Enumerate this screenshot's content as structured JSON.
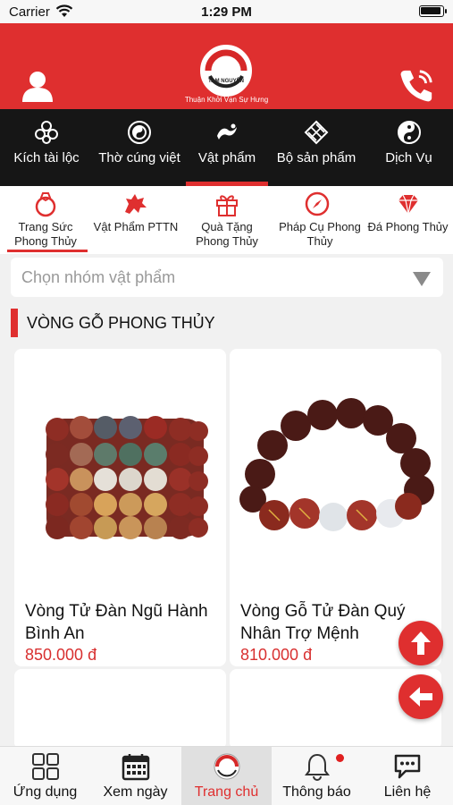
{
  "status_bar": {
    "carrier": "Carrier",
    "time": "1:29 PM"
  },
  "header": {
    "logo_text": "TAM NGUYÊN",
    "tagline": "Thuận Khởi Vạn Sự Hưng",
    "brand_color": "#df2f2f"
  },
  "categories": [
    {
      "label": "Kích tài lộc",
      "icon": "lotus-knot-icon"
    },
    {
      "label": "Thờ cúng việt",
      "icon": "bagua-icon"
    },
    {
      "label": "Vật phẩm",
      "icon": "dragon-icon",
      "active": true
    },
    {
      "label": "Bộ sản phẩm",
      "icon": "endless-knot-icon"
    },
    {
      "label": "Dịch Vụ",
      "icon": "yin-yang-icon"
    }
  ],
  "subcategories": [
    {
      "label": "Trang Sức Phong Thủy",
      "icon": "ring-icon",
      "active": true
    },
    {
      "label": "Vật Phẩm PTTN",
      "icon": "qilin-icon"
    },
    {
      "label": "Quà Tặng Phong Thủy",
      "icon": "gift-icon"
    },
    {
      "label": "Pháp Cụ Phong Thủy",
      "icon": "compass-icon"
    },
    {
      "label": "Đá Phong Thủy",
      "icon": "diamond-icon"
    }
  ],
  "filter": {
    "placeholder": "Chọn nhóm vật phẩm"
  },
  "section": {
    "title": "VÒNG GỖ PHONG THỦY"
  },
  "products": [
    {
      "name": "Vòng Tử Đàn Ngũ Hành Bình An",
      "price": "850.000 đ"
    },
    {
      "name": "Vòng Gỗ Tử Đàn Quý Nhân Trợ Mệnh",
      "price": "810.000 đ"
    }
  ],
  "tabs": [
    {
      "label": "Ứng dụng",
      "icon": "apps-grid-icon"
    },
    {
      "label": "Xem ngày",
      "icon": "calendar-icon"
    },
    {
      "label": "Trang chủ",
      "icon": "home-logo-icon",
      "active": true
    },
    {
      "label": "Thông báo",
      "icon": "bell-icon",
      "badge": true
    },
    {
      "label": "Liên hệ",
      "icon": "chat-icon"
    }
  ]
}
